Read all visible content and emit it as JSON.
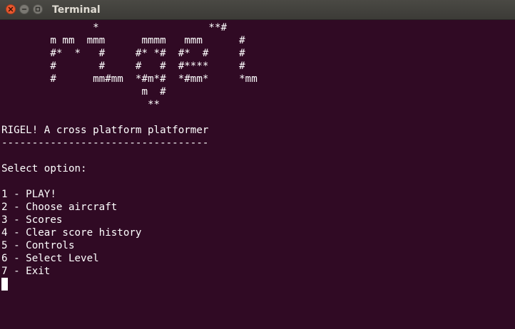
{
  "window": {
    "title": "Terminal",
    "close_icon": "close-icon",
    "minimize_icon": "minimize-icon",
    "maximize_icon": "maximize-icon"
  },
  "terminal": {
    "colors": {
      "background": "#300a24",
      "foreground": "#ffffff",
      "titlebar": "#3c3b37",
      "close_button": "#e9582f"
    },
    "ascii_art": [
      "               *                  **#",
      "        m mm  mmm      mmmm   mmm      #",
      "        #*  *   #     #* *#  #*  #     #",
      "        #       #     #   #  #****     #",
      "        #      mm#mm  *#m*#  *#mm*     *mm",
      "                       m  #",
      "                        **"
    ],
    "heading": "RIGEL! A cross platform platformer",
    "divider": "----------------------------------",
    "prompt": "Select option:",
    "options": [
      "1 - PLAY!",
      "2 - Choose aircraft",
      "3 - Scores",
      "4 - Clear score history",
      "5 - Controls",
      "6 - Select Level",
      "7 - Exit"
    ]
  }
}
